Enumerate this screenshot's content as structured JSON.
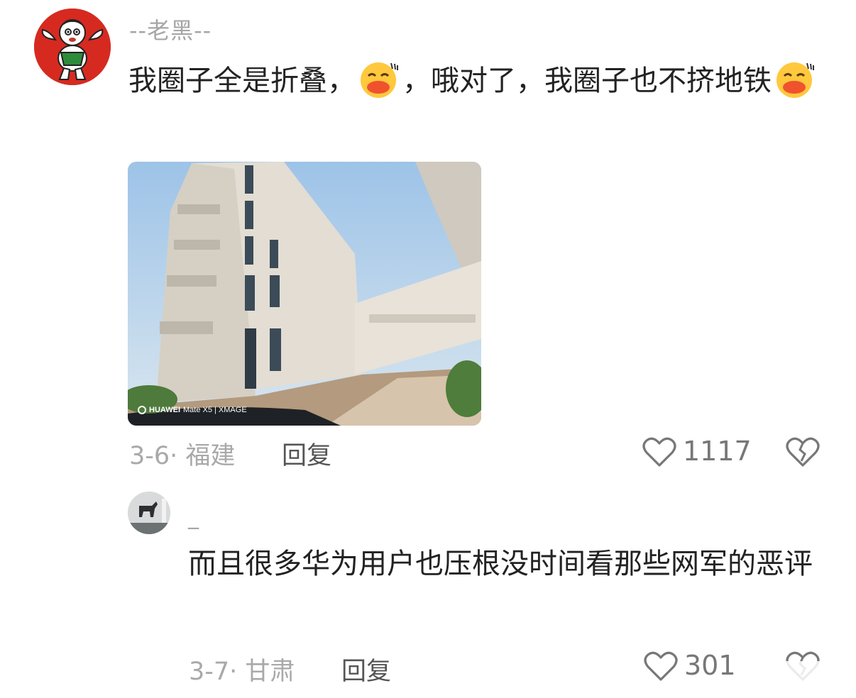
{
  "comments": [
    {
      "author": "--老黑--",
      "text_part1": "我圈子全是折叠，",
      "text_part2": "，哦对了，我圈子也不挤地铁",
      "emoji_icon": "blushing-smile-emoji",
      "photo": {
        "watermark_brand": "HUAWEI",
        "watermark_model": "Mate X5 | XMAGE"
      },
      "date_location": "3-6· 福建",
      "reply_label": "回复",
      "like_count": "1117"
    },
    {
      "author": "_",
      "text": "而且很多华为用户也压根没时间看那些网军的恶评",
      "date_location": "3-7· 甘肃",
      "reply_label": "回复",
      "like_count": "301"
    }
  ],
  "colors": {
    "meta_text": "#a9a9a9",
    "body_text": "#222222",
    "avatar_red": "#d62a20"
  }
}
